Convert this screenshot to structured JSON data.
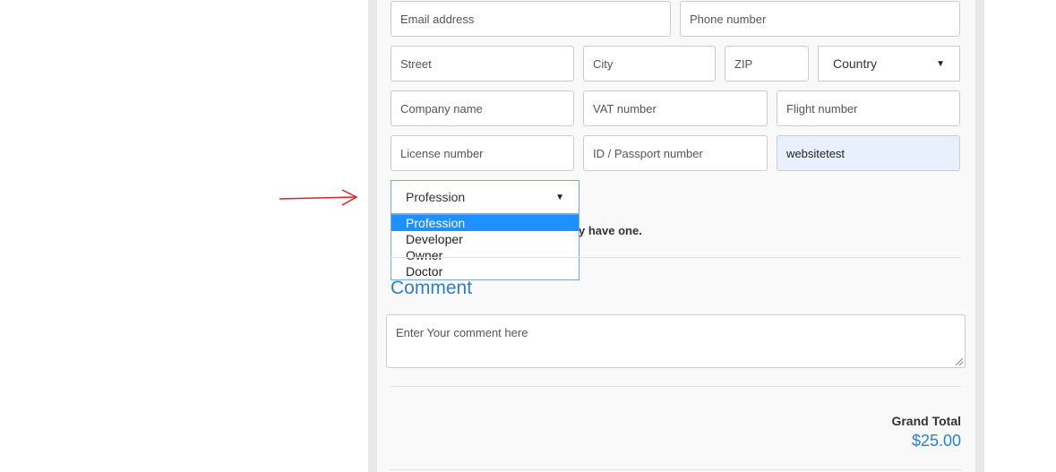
{
  "fields": {
    "email": "Email address",
    "phone": "Phone number",
    "street": "Street",
    "city": "City",
    "zip": "ZIP",
    "country": "Country",
    "company": "Company name",
    "vat": "VAT number",
    "flight": "Flight number",
    "license": "License number",
    "passport": "ID / Passport number",
    "website_value": "websitetest"
  },
  "profession": {
    "selected": "Profession",
    "options": [
      "Profession",
      "Developer",
      "Owner",
      "Doctor"
    ]
  },
  "hint_text": "y have one.",
  "comment": {
    "title": "Comment",
    "placeholder": "Enter Your comment here"
  },
  "totals": {
    "label": "Grand Total",
    "value": "$25.00"
  },
  "colors": {
    "accent": "#2a7fd4",
    "selected_option": "#1e90ff",
    "annotation_arrow": "#e02020"
  }
}
